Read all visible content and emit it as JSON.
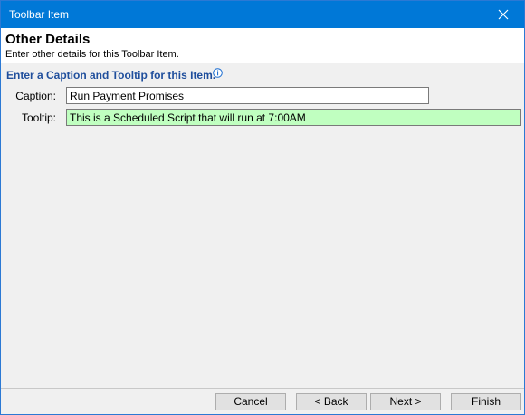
{
  "window": {
    "title": "Toolbar Item"
  },
  "header": {
    "title": "Other Details",
    "subtitle": "Enter other details for this Toolbar Item."
  },
  "section": {
    "heading": "Enter a Caption and Tooltip for this Item."
  },
  "form": {
    "caption_label": "Caption:",
    "caption_value": "Run Payment Promises",
    "tooltip_label": "Tooltip:",
    "tooltip_value": "This is a Scheduled Script that will run at 7:00AM"
  },
  "buttons": {
    "cancel": "Cancel",
    "back": "< Back",
    "next": "Next >",
    "finish": "Finish"
  },
  "icons": {
    "close": "close-icon",
    "info": "info-icon"
  },
  "colors": {
    "titlebar": "#0078d7",
    "heading": "#1f4e9c",
    "tooltip_field_bg": "#c0ffc0"
  }
}
